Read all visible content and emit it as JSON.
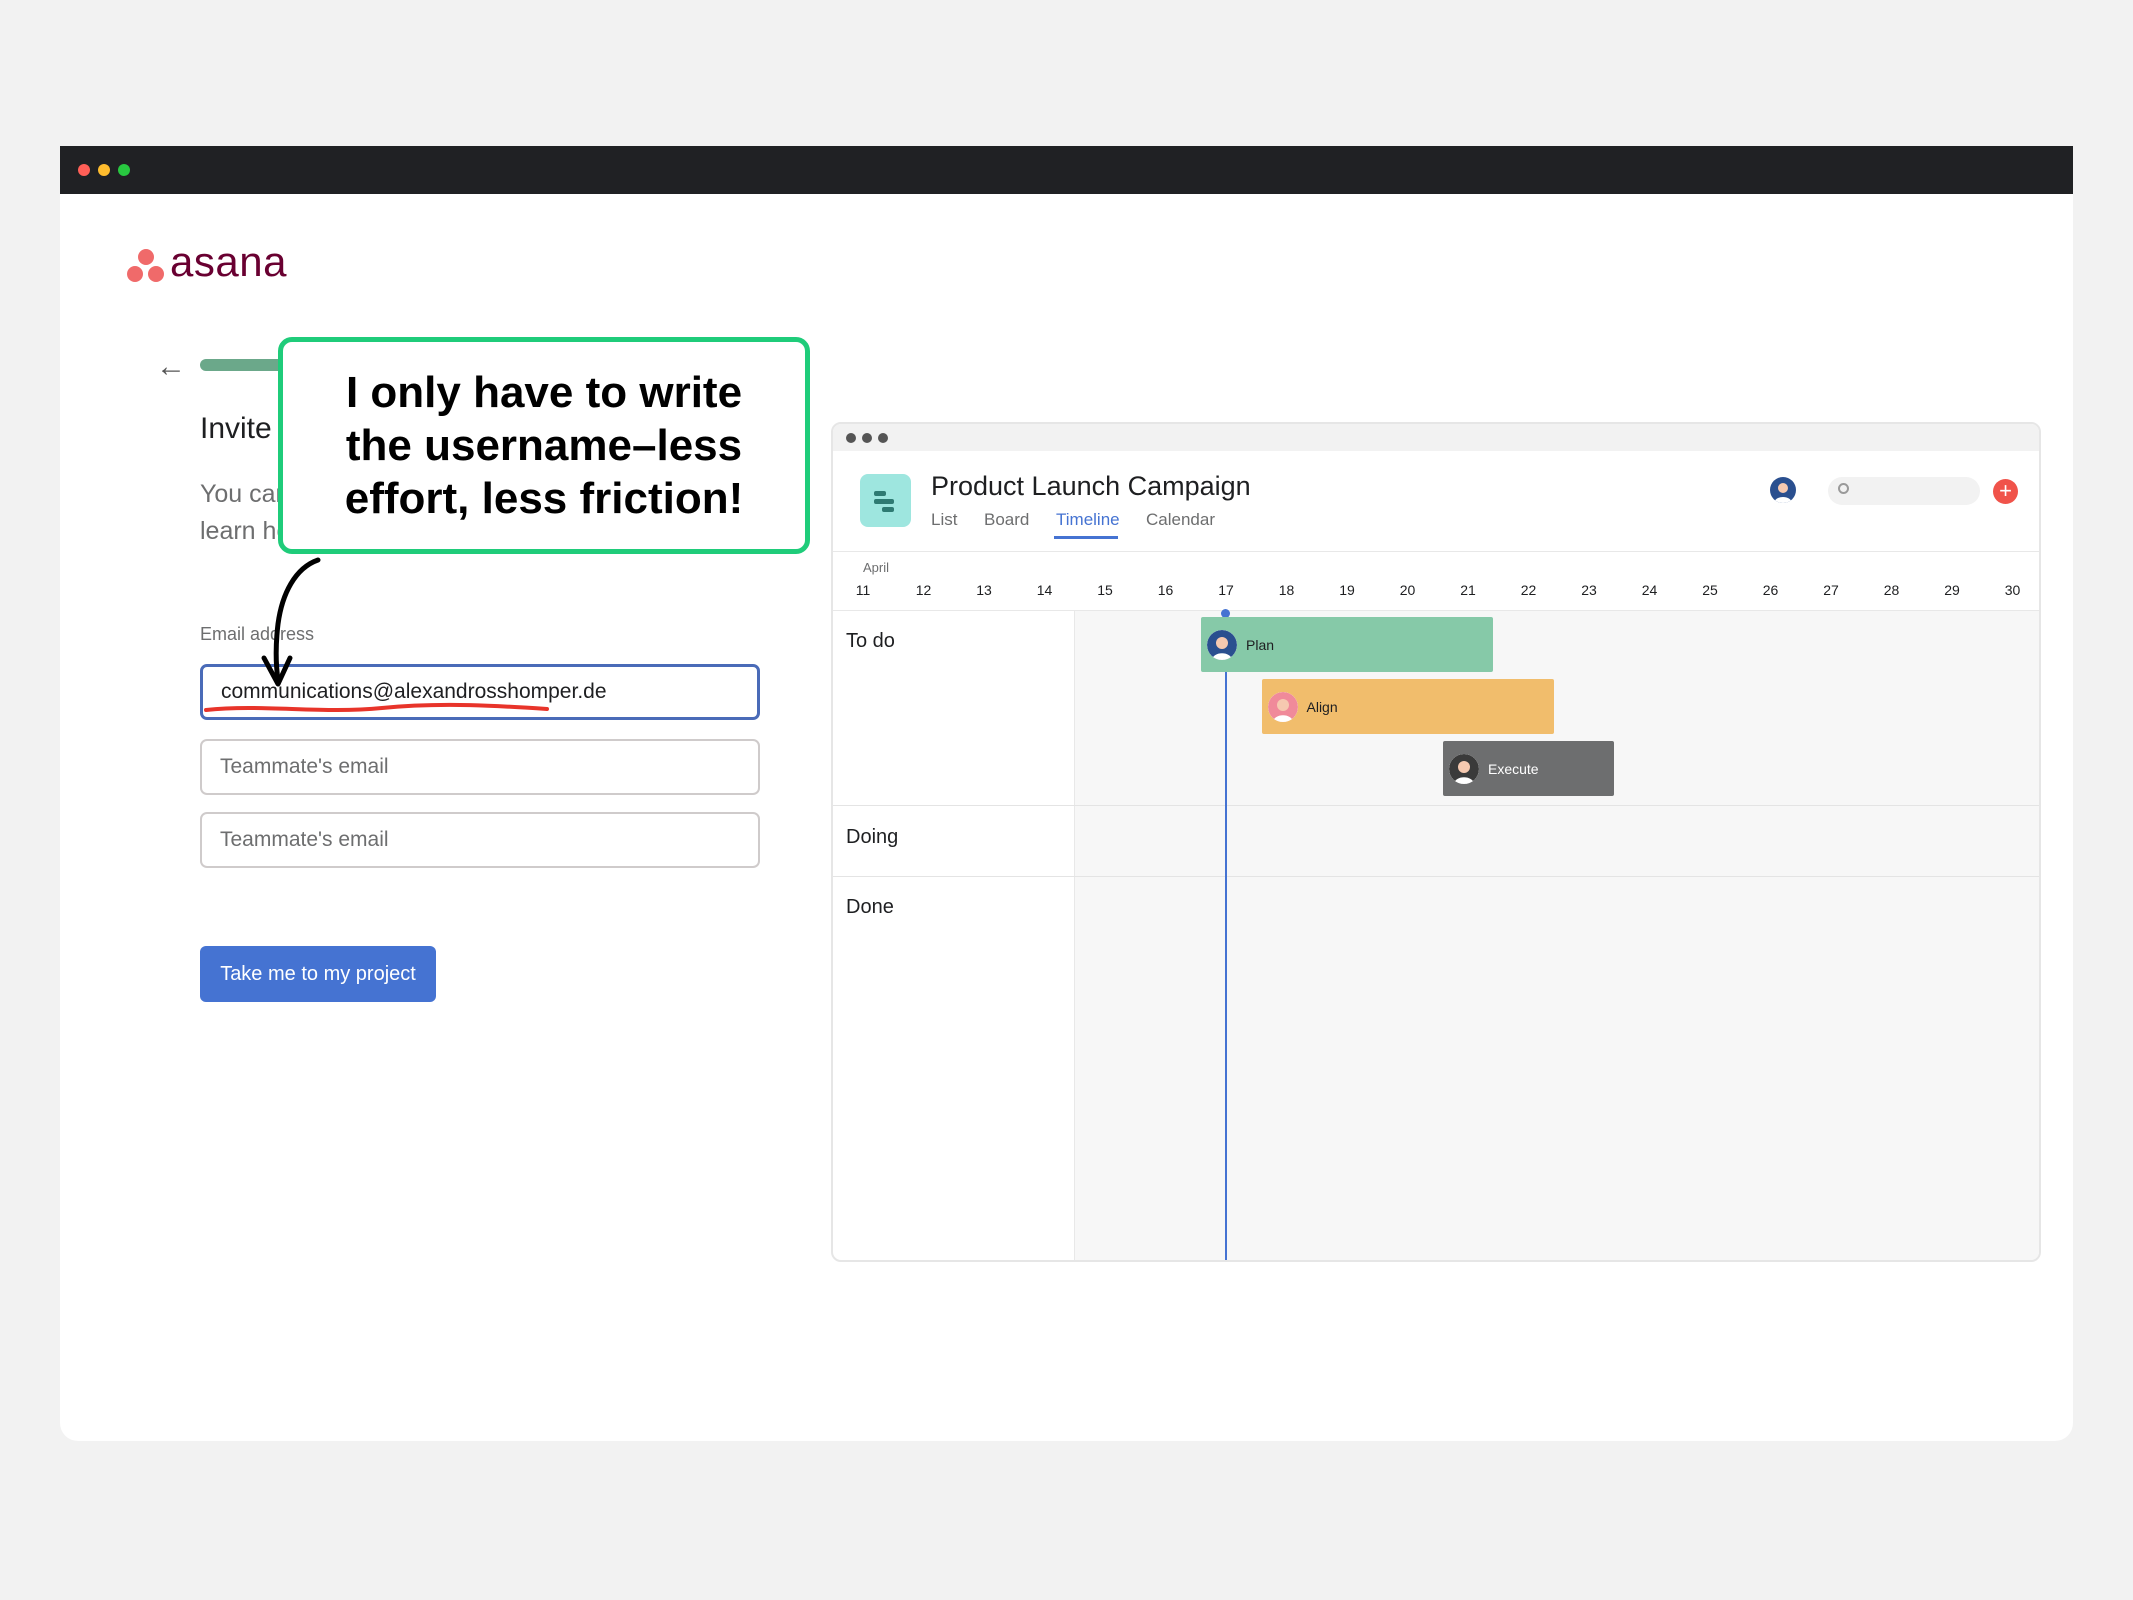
{
  "brand": {
    "name": "asana",
    "logo_color": "#f06a6a",
    "wordmark_color": "#690031"
  },
  "onboarding": {
    "heading": "Invite a",
    "description_line1": "You can",
    "description_line2": "learn ho",
    "email_label": "Email address",
    "email_value": "communications@alexandrosshomper.de",
    "teammate_placeholder_1": "Teammate's email",
    "teammate_placeholder_2": "Teammate's email",
    "cta_label": "Take me to my project",
    "cta_color": "#4573d2"
  },
  "callout": {
    "line1": "I only have to write",
    "line2": "the username–less",
    "line3": "effort, less friction!",
    "border_color": "#1fcc7a"
  },
  "preview": {
    "project_title": "Product Launch Campaign",
    "tabs": [
      "List",
      "Board",
      "Timeline",
      "Calendar"
    ],
    "selected_tab": "Timeline",
    "add_icon": "+",
    "month": "April",
    "days": [
      "11",
      "12",
      "13",
      "14",
      "15",
      "16",
      "17",
      "18",
      "19",
      "20",
      "21",
      "22",
      "23",
      "24",
      "25",
      "26",
      "27",
      "28",
      "29",
      "30"
    ],
    "today": "17",
    "sections": [
      "To do",
      "Doing",
      "Done"
    ],
    "tasks": [
      {
        "name": "Plan",
        "start": "17",
        "end": "21",
        "color": "#86c9a8"
      },
      {
        "name": "Align",
        "start": "18",
        "end": "22",
        "color": "#f1bd6c"
      },
      {
        "name": "Execute",
        "start": "21",
        "end": "23",
        "color": "#6d6e6f"
      }
    ]
  }
}
